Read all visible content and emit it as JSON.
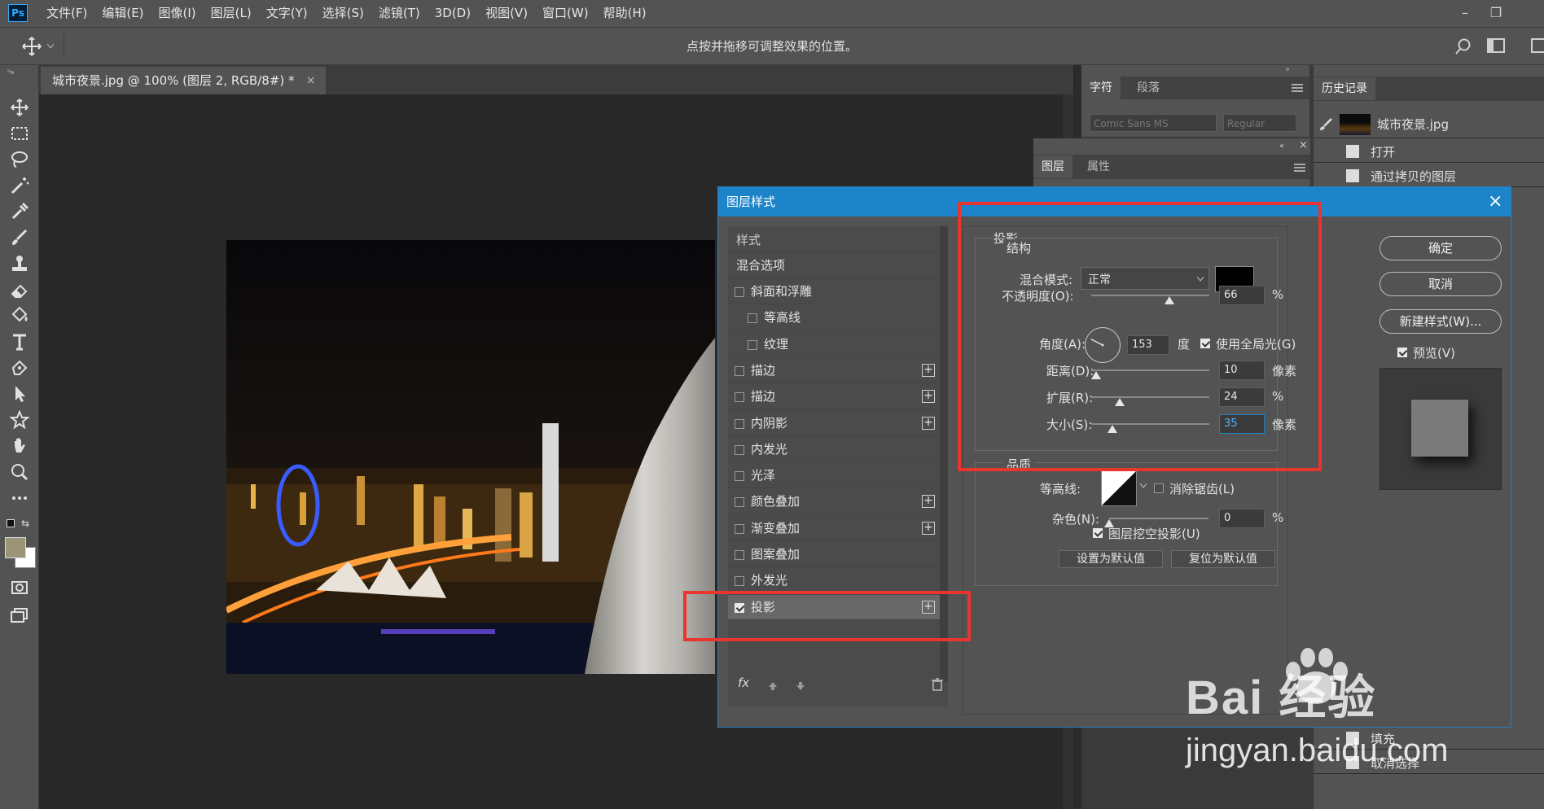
{
  "app": {
    "logo": "Ps",
    "menu": [
      "文件(F)",
      "编辑(E)",
      "图像(I)",
      "图层(L)",
      "文字(Y)",
      "选择(S)",
      "滤镜(T)",
      "3D(D)",
      "视图(V)",
      "窗口(W)",
      "帮助(H)"
    ],
    "window_controls": [
      "–",
      "❐"
    ]
  },
  "options_bar": {
    "hint": "点按并拖移可调整效果的位置。"
  },
  "document_tab": {
    "title": "城市夜景.jpg @ 100% (图层 2, RGB/8#) *",
    "close": "×"
  },
  "character_panel": {
    "tabs": [
      "字符",
      "段落"
    ],
    "font_family": "Comic Sans MS",
    "font_style": "Regular"
  },
  "layers_panel": {
    "tabs": [
      "图层",
      "属性"
    ]
  },
  "history_panel": {
    "tab": "历史记录",
    "snapshot": "城市夜景.jpg",
    "items": [
      "打开",
      "通过拷贝的图层"
    ],
    "items_bottom": [
      "填充",
      "取消选择"
    ]
  },
  "dialog": {
    "title": "图层样式",
    "close": "×",
    "styles_header": "样式",
    "blend_options": "混合选项",
    "style_items": [
      {
        "label": "斜面和浮雕",
        "checked": false,
        "plus": false,
        "indent": false
      },
      {
        "label": "等高线",
        "checked": false,
        "plus": false,
        "indent": true
      },
      {
        "label": "纹理",
        "checked": false,
        "plus": false,
        "indent": true
      },
      {
        "label": "描边",
        "checked": false,
        "plus": true,
        "indent": false
      },
      {
        "label": "描边",
        "checked": false,
        "plus": true,
        "indent": false
      },
      {
        "label": "内阴影",
        "checked": false,
        "plus": true,
        "indent": false
      },
      {
        "label": "内发光",
        "checked": false,
        "plus": false,
        "indent": false
      },
      {
        "label": "光泽",
        "checked": false,
        "plus": false,
        "indent": false
      },
      {
        "label": "颜色叠加",
        "checked": false,
        "plus": true,
        "indent": false
      },
      {
        "label": "渐变叠加",
        "checked": false,
        "plus": true,
        "indent": false
      },
      {
        "label": "图案叠加",
        "checked": false,
        "plus": false,
        "indent": false
      },
      {
        "label": "外发光",
        "checked": false,
        "plus": false,
        "indent": false
      },
      {
        "label": "投影",
        "checked": true,
        "plus": true,
        "indent": false
      }
    ],
    "fx_label": "fx",
    "section_title": "投影",
    "structure_title": "结构",
    "blend_mode": {
      "label": "混合模式:",
      "value": "正常",
      "color": "#000000"
    },
    "opacity": {
      "label": "不透明度(O):",
      "value": "66",
      "unit": "%",
      "level": 66
    },
    "angle": {
      "label": "角度(A):",
      "value": "153",
      "unit": "度",
      "global_light_label": "使用全局光(G)",
      "global_light": true
    },
    "distance": {
      "label": "距离(D):",
      "value": "10",
      "unit": "像素",
      "level": 4
    },
    "spread": {
      "label": "扩展(R):",
      "value": "24",
      "unit": "%",
      "level": 24
    },
    "size": {
      "label": "大小(S):",
      "value": "35",
      "unit": "像素",
      "level": 18
    },
    "quality_title": "品质",
    "contour_label": "等高线:",
    "anti_alias_label": "消除锯齿(L)",
    "noise": {
      "label": "杂色(N):",
      "value": "0",
      "unit": "%",
      "level": 0
    },
    "knockout_label": "图层挖空投影(U)",
    "set_default": "设置为默认值",
    "reset_default": "复位为默认值",
    "ok": "确定",
    "cancel": "取消",
    "new_style": "新建样式(W)...",
    "preview_label": "预览(V)"
  },
  "watermark": {
    "logo": "Bai 经验",
    "url": "jingyan.baidu.com"
  },
  "colors": {
    "dialog_title": "#1d84c9",
    "highlight_box": "#e8352f"
  }
}
